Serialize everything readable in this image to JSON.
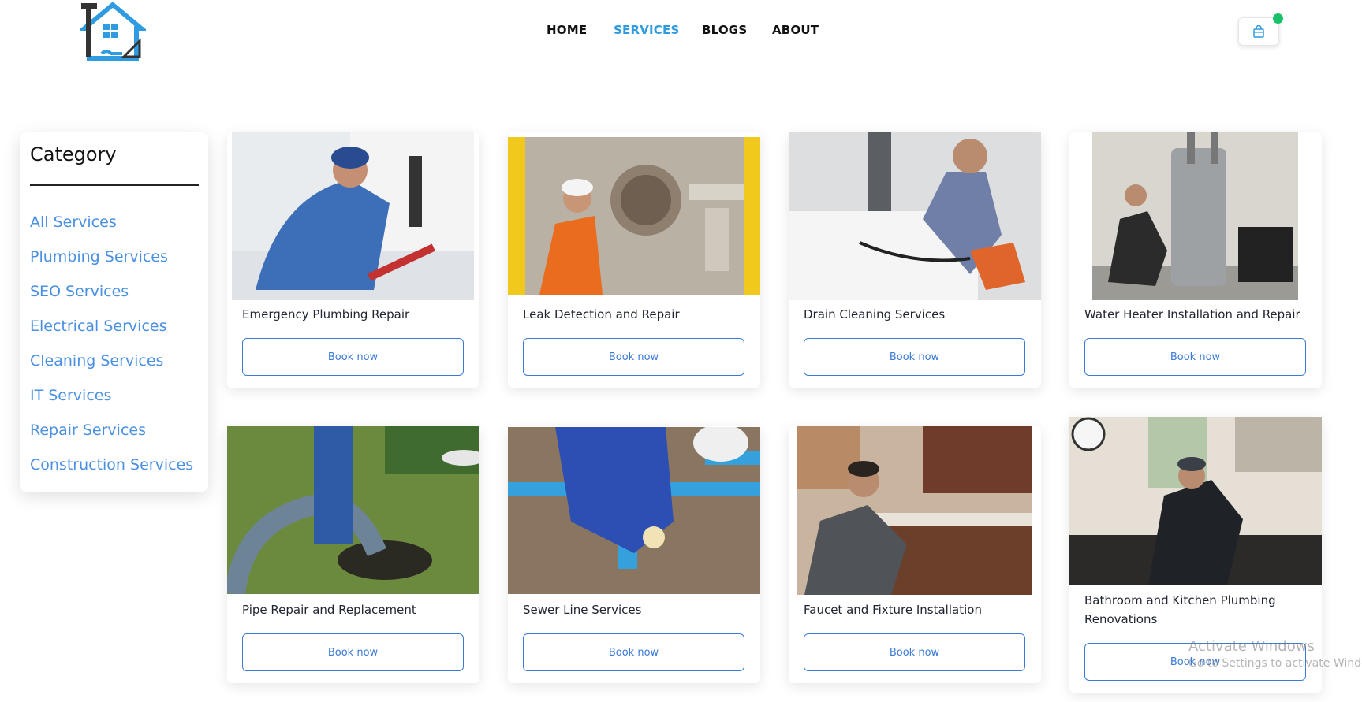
{
  "header": {
    "nav": [
      {
        "label": "HOME",
        "active": false
      },
      {
        "label": "SERVICES",
        "active": true
      },
      {
        "label": "BLOGS",
        "active": false
      },
      {
        "label": "ABOUT",
        "active": false
      }
    ],
    "cart_icon": "shopping-bag-icon",
    "cart_badge_color": "#17c26b",
    "logo_icon": "house-tools-logo"
  },
  "sidebar": {
    "title": "Category",
    "items": [
      "All Services",
      "Plumbing Services",
      "SEO Services",
      "Electrical Services",
      "Cleaning Services",
      "IT Services",
      "Repair Services",
      "Construction Services"
    ]
  },
  "services": [
    {
      "title": "Emergency Plumbing Repair",
      "button": "Book now"
    },
    {
      "title": "Leak Detection and Repair",
      "button": "Book now"
    },
    {
      "title": "Drain Cleaning Services",
      "button": "Book now"
    },
    {
      "title": "Water Heater Installation and Repair",
      "button": "Book now"
    },
    {
      "title": "Pipe Repair and Replacement",
      "button": "Book now"
    },
    {
      "title": "Sewer Line Services",
      "button": "Book now"
    },
    {
      "title": "Faucet and Fixture Installation",
      "button": "Book now"
    },
    {
      "title": "Bathroom and Kitchen Plumbing Renovations",
      "button": "Book now"
    }
  ],
  "watermark": {
    "line1": "Activate Windows",
    "line2": "Go to Settings to activate Windows."
  },
  "colors": {
    "accent": "#2f9be0",
    "category_link": "#4a90e2",
    "button_border": "#3b7bd8"
  }
}
